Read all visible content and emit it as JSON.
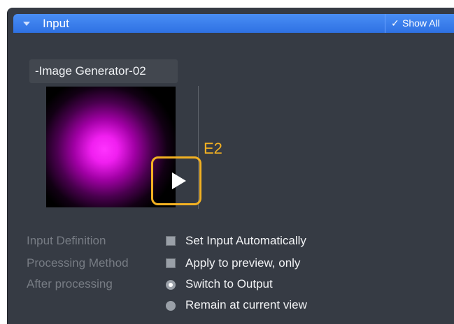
{
  "header": {
    "title": "Input",
    "show_all_label": "Show All",
    "caret_icon": "caret-down",
    "check_icon": "checkmark"
  },
  "image": {
    "name": "-Image Generator-02"
  },
  "step_label": "E2",
  "play_icon": "play",
  "highlight_color": "#f3b122",
  "accent_color": "#3a7ff0",
  "settings": {
    "input_definition": {
      "label": "Input Definition",
      "option": "Set Input Automatically",
      "checked": false
    },
    "processing_method": {
      "label": "Processing Method",
      "option": "Apply to preview, only",
      "checked": false
    },
    "after_processing": {
      "label": "After processing",
      "options": [
        {
          "label": "Switch to Output",
          "selected": true
        },
        {
          "label": "Remain at current view",
          "selected": false
        }
      ]
    }
  }
}
